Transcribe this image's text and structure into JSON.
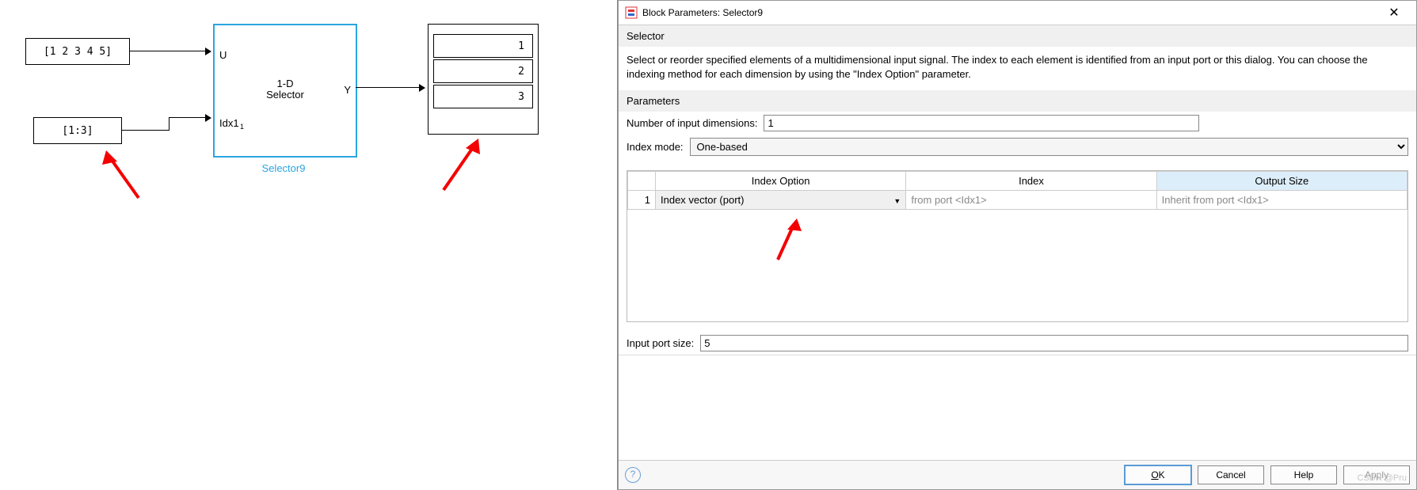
{
  "canvas": {
    "const1": "[1 2 3 4 5]",
    "const2": "[1:3]",
    "selector": {
      "line1": "1-D",
      "line2": "Selector",
      "portU": "U",
      "portIdx": "Idx1",
      "portIdxSub": "1",
      "portY": "Y",
      "name": "Selector9"
    },
    "display": [
      "1",
      "2",
      "3"
    ]
  },
  "dialog": {
    "title": "Block Parameters: Selector9",
    "section": "Selector",
    "description": "Select or reorder specified elements of a multidimensional input signal. The index to each element is identified from an input port or this dialog. You can choose the indexing method for each dimension by using the \"Index Option\" parameter.",
    "paramsLabel": "Parameters",
    "numDimLabel": "Number of input dimensions:",
    "numDimValue": "1",
    "idxModeLabel": "Index mode:",
    "idxModeValue": "One-based",
    "table": {
      "headers": {
        "opt": "Index Option",
        "idx": "Index",
        "out": "Output Size"
      },
      "rownum": "1",
      "optValue": "Index vector (port)",
      "idxValue": "from port <Idx1>",
      "outValue": "Inherit from port <Idx1>"
    },
    "inputPortSizeLabel": "Input port size:",
    "inputPortSizeValue": "5",
    "buttons": {
      "ok": "OK",
      "cancel": "Cancel",
      "help": "Help",
      "apply": "Apply"
    }
  },
  "watermark": "CSDN @Pru"
}
